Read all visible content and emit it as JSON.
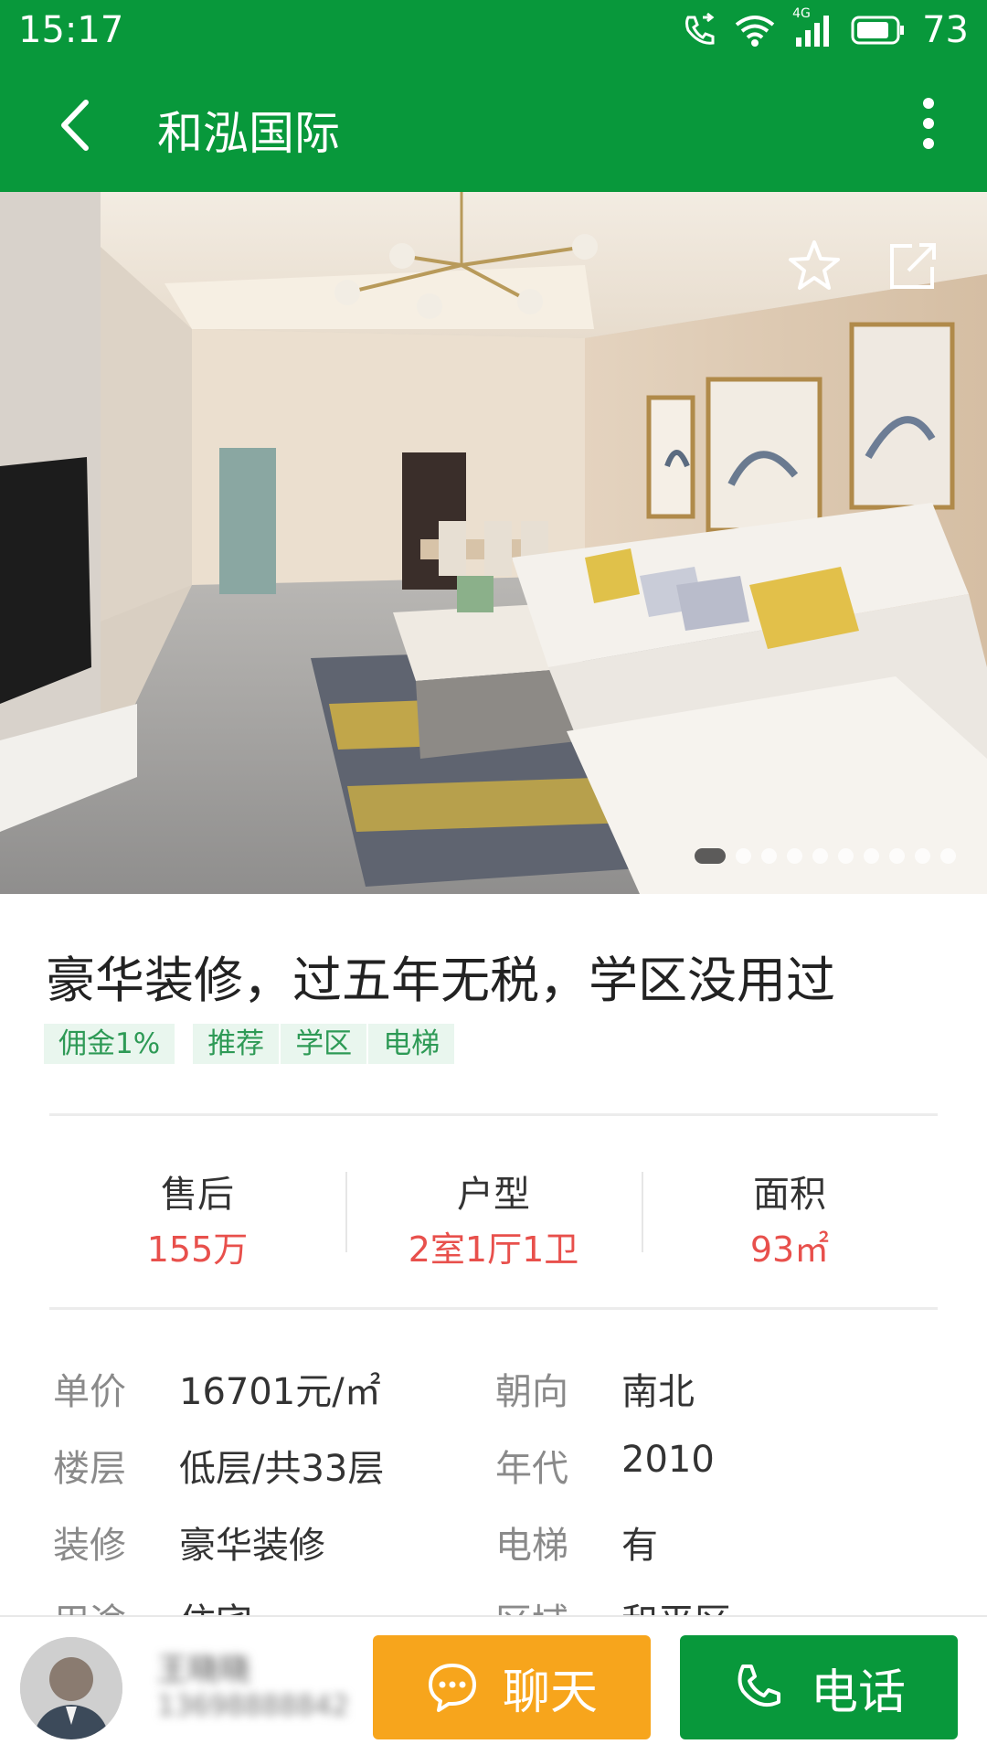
{
  "status_bar": {
    "time": "15:17",
    "network": "4G",
    "battery": "73"
  },
  "app_bar": {
    "title": "和泓国际",
    "back_icon": "chevron-left-icon",
    "more_icon": "more-vertical-icon"
  },
  "gallery": {
    "image_count": 10,
    "current_index": 1,
    "favorite_icon": "star-icon",
    "share_icon": "share-icon"
  },
  "listing": {
    "title": "豪华装修，过五年无税，学区没用过",
    "tags": [
      "佣金1%",
      "推荐",
      "学区",
      "电梯"
    ]
  },
  "stats": [
    {
      "label": "售后",
      "value": "155万"
    },
    {
      "label": "户型",
      "value": "2室1厅1卫"
    },
    {
      "label": "面积",
      "value": "93㎡"
    }
  ],
  "details": [
    {
      "label1": "单价",
      "value1": "16701元/㎡",
      "label2": "朝向",
      "value2": "南北"
    },
    {
      "label1": "楼层",
      "value1": "低层/共33层",
      "label2": "年代",
      "value2": "2010"
    },
    {
      "label1": "装修",
      "value1": "豪华装修",
      "label2": "电梯",
      "value2": "有"
    },
    {
      "label1": "用途",
      "value1": "住宅",
      "label2": "区域",
      "value2": "和平区"
    }
  ],
  "agent": {
    "name": "王晓晓",
    "phone": "13698888842"
  },
  "actions": {
    "chat_label": "聊天",
    "call_label": "电话"
  },
  "colors": {
    "primary": "#08983b",
    "accent_orange": "#f7a51c",
    "price_red": "#e8504c",
    "tag_green": "#2e9a56"
  }
}
